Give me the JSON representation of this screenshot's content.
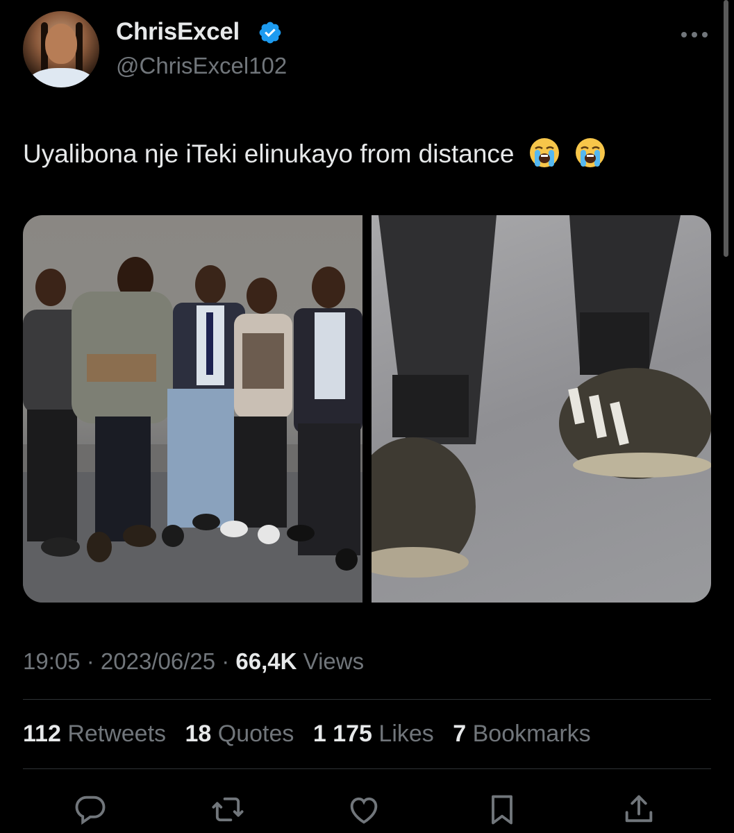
{
  "author": {
    "display_name": "ChrisExcel",
    "handle": "@ChrisExcel102",
    "verified_icon": "verified-badge-icon"
  },
  "tweet": {
    "text": "Uyalibona nje iTeki elinukayo from distance",
    "emojis": [
      "loudly-crying-face",
      "loudly-crying-face"
    ]
  },
  "media": {
    "images": [
      {
        "name": "group-photo",
        "description_icon": "photo"
      },
      {
        "name": "shoes-closeup",
        "description_icon": "photo"
      }
    ]
  },
  "meta": {
    "time": "19:05",
    "separator": " · ",
    "date": "2023/06/25",
    "views_count": "66,4K",
    "views_label": "Views"
  },
  "stats": {
    "retweets_count": "112",
    "retweets_label": "Retweets",
    "quotes_count": "18",
    "quotes_label": "Quotes",
    "likes_count": "1 175",
    "likes_label": "Likes",
    "bookmarks_count": "7",
    "bookmarks_label": "Bookmarks"
  },
  "actions": [
    "reply-icon",
    "retweet-icon",
    "like-icon",
    "bookmark-icon",
    "share-icon"
  ],
  "colors": {
    "background": "#000000",
    "primary_text": "#e7e9ea",
    "secondary_text": "#71767b",
    "verified_blue": "#1d9bf0",
    "divider": "#2f3336"
  }
}
